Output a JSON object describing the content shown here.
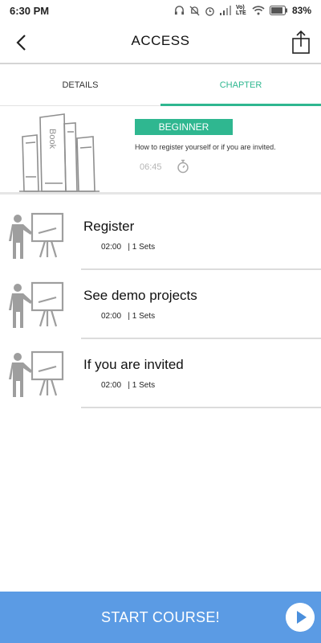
{
  "status_bar": {
    "time": "6:30 PM",
    "battery": "83%",
    "network": "Vo) LTE",
    "icons": [
      "headset-icon",
      "muted-bell-icon",
      "alarm-icon",
      "signal-icon",
      "wifi-icon",
      "battery-icon"
    ]
  },
  "header": {
    "title": "ACCESS",
    "back_icon": "chevron-left-icon",
    "share_icon": "share-icon"
  },
  "tabs": [
    {
      "label": "DETAILS",
      "active": false
    },
    {
      "label": "CHAPTER",
      "active": true
    }
  ],
  "hero": {
    "level": "BEGINNER",
    "description": "How to register yourself or if you are invited.",
    "duration": "06:45",
    "illustration_text": "Book"
  },
  "lessons": [
    {
      "title": "Register",
      "duration": "02:00",
      "sets": "| 1 Sets"
    },
    {
      "title": "See demo projects",
      "duration": "02:00",
      "sets": "| 1 Sets"
    },
    {
      "title": "If you are invited",
      "duration": "02:00",
      "sets": "| 1 Sets"
    }
  ],
  "footer": {
    "start_label": "START COURSE!",
    "play_icon": "play-icon"
  },
  "colors": {
    "accent": "#2fb790",
    "start_bar": "#5b9be4",
    "icon_gray": "#9e9e9e"
  }
}
